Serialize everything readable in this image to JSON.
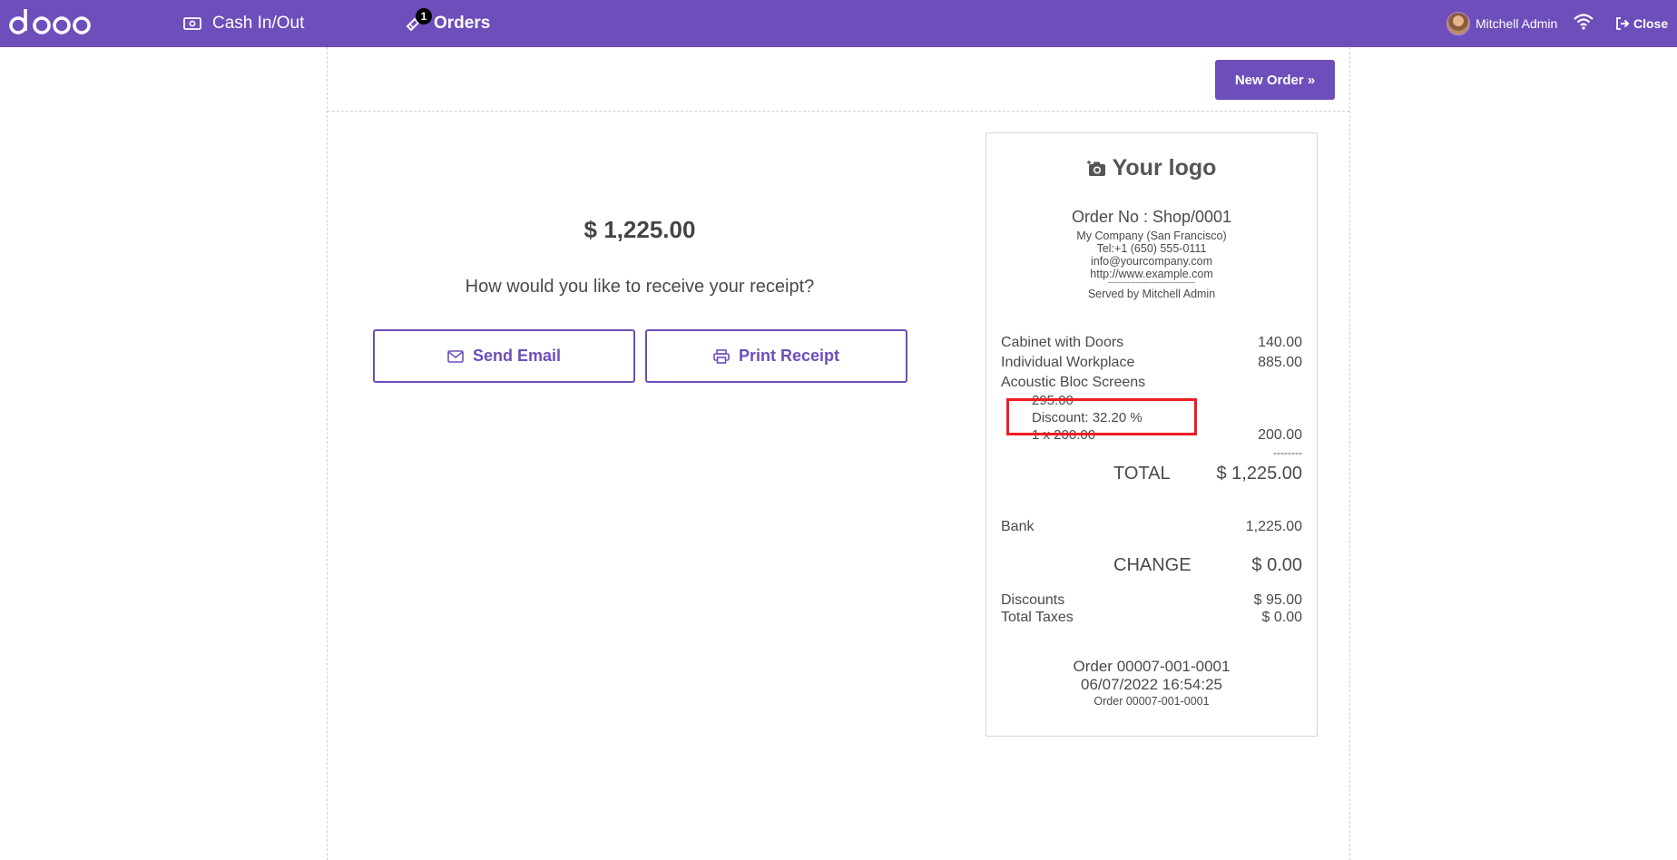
{
  "topbar": {
    "logo_text": "odoo",
    "cash_label": "Cash In/Out",
    "orders_label": "Orders",
    "orders_badge": "1",
    "user_name": "Mitchell Admin",
    "close_label": "Close",
    "bar_color": "#6d4ebb"
  },
  "header": {
    "new_order_label": "New Order »"
  },
  "payment": {
    "amount": "$ 1,225.00",
    "question": "How would you like to receive your receipt?",
    "send_email_label": "Send Email",
    "print_receipt_label": "Print Receipt"
  },
  "receipt": {
    "logo_text": "Your logo",
    "order_no": "Order No : Shop/0001",
    "company": "My Company (San Francisco)",
    "tel": "Tel:+1 (650) 555-0111",
    "email": "info@yourcompany.com",
    "website": "http://www.example.com",
    "divider": "--------------------------------",
    "served_by": "Served by Mitchell Admin",
    "lines": [
      {
        "name": "Cabinet with Doors",
        "price": "140.00"
      },
      {
        "name": "Individual Workplace",
        "price": "885.00"
      },
      {
        "name": "Acoustic Bloc Screens",
        "price": ""
      }
    ],
    "line3_old_price": "295.00",
    "line3_discount": "Discount: 32.20 %",
    "line3_qty": "1 x 200.00",
    "line3_price": "200.00",
    "subtotal_sep": "--------",
    "total_label": "TOTAL",
    "total_value": "$ 1,225.00",
    "payment_method": "Bank",
    "payment_amount": "1,225.00",
    "change_label": "CHANGE",
    "change_value": "$ 0.00",
    "discounts_label": "Discounts",
    "discounts_value": "$ 95.00",
    "taxes_label": "Total Taxes",
    "taxes_value": "$ 0.00",
    "footer_order": "Order 00007-001-0001",
    "footer_date": "06/07/2022 16:54:25",
    "footer_order_small": "Order 00007-001-0001"
  },
  "annotation": {
    "highlight_color": "#ee1c24"
  }
}
